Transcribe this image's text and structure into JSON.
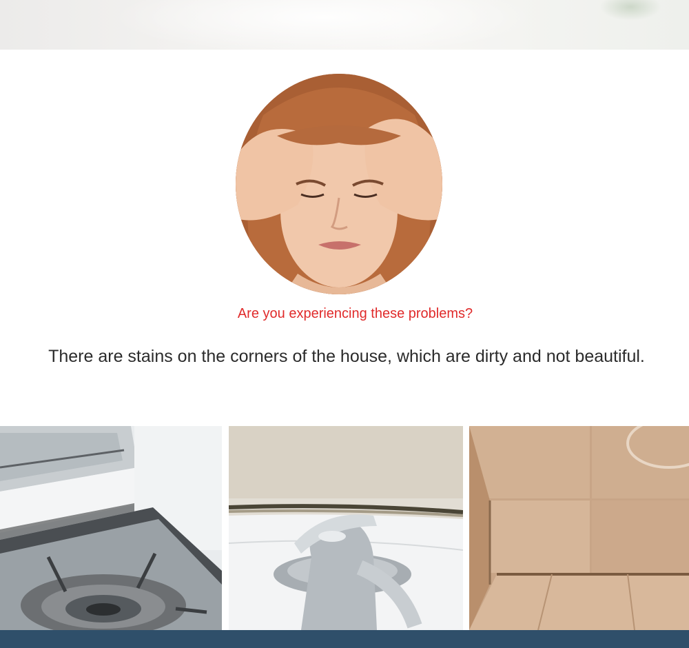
{
  "header": {
    "question": "Are you experiencing these problems?",
    "statement": "There are stains on the corners of the house, which are dirty and not beautiful."
  },
  "images": {
    "portrait": "stressed-woman-portrait",
    "photos": [
      "stained-stove-corner",
      "moldy-faucet-edge",
      "dirty-floor-corner"
    ]
  },
  "colors": {
    "question_text": "#e02a2a",
    "statement_text": "#2b2b2b",
    "bottom_bar": "#2f4f6a"
  }
}
